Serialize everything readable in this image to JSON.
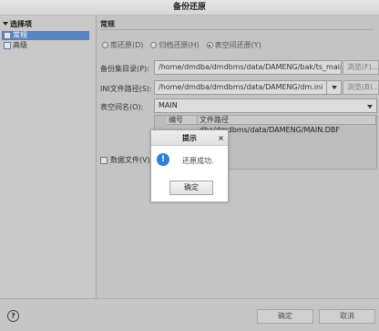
{
  "window": {
    "title": "备份还原"
  },
  "left_panel": {
    "header": "选择项",
    "items": [
      {
        "label": "常规",
        "selected": true
      },
      {
        "label": "高级",
        "selected": false
      }
    ]
  },
  "main": {
    "section_title": "常规",
    "restore_modes": [
      {
        "label": "库还原(D)",
        "selected": false
      },
      {
        "label": "归档还原(H)",
        "selected": false
      },
      {
        "label": "表空间还原(Y)",
        "selected": true
      }
    ],
    "backup_dir": {
      "label": "备份集目录(P):",
      "value": "/home/dmdba/dmdbms/data/DAMENG/bak/ts_main_bak",
      "browse_label": "浏览(F)..."
    },
    "ini_path": {
      "label": "INI文件路径(S):",
      "value": "/home/dmdba/dmdbms/data/DAMENG/dm.ini",
      "browse_label": "浏览(B)..."
    },
    "tablespace": {
      "label": "表空间名(O):",
      "value": "MAIN"
    },
    "file_table": {
      "headers": [
        "编号",
        "文件路径"
      ],
      "rows": [
        {
          "path": "dba/dmdbms/data/DAMENG/MAIN.DBF"
        }
      ]
    },
    "datafile_checkbox": {
      "label": "数据文件(V)",
      "checked": false
    }
  },
  "footer": {
    "help": "?",
    "ok_label": "确定",
    "cancel_label": "取消"
  },
  "dialog": {
    "title": "提示",
    "close": "×",
    "icon": "info-icon",
    "message": "还原成功.",
    "ok_label": "确定"
  }
}
